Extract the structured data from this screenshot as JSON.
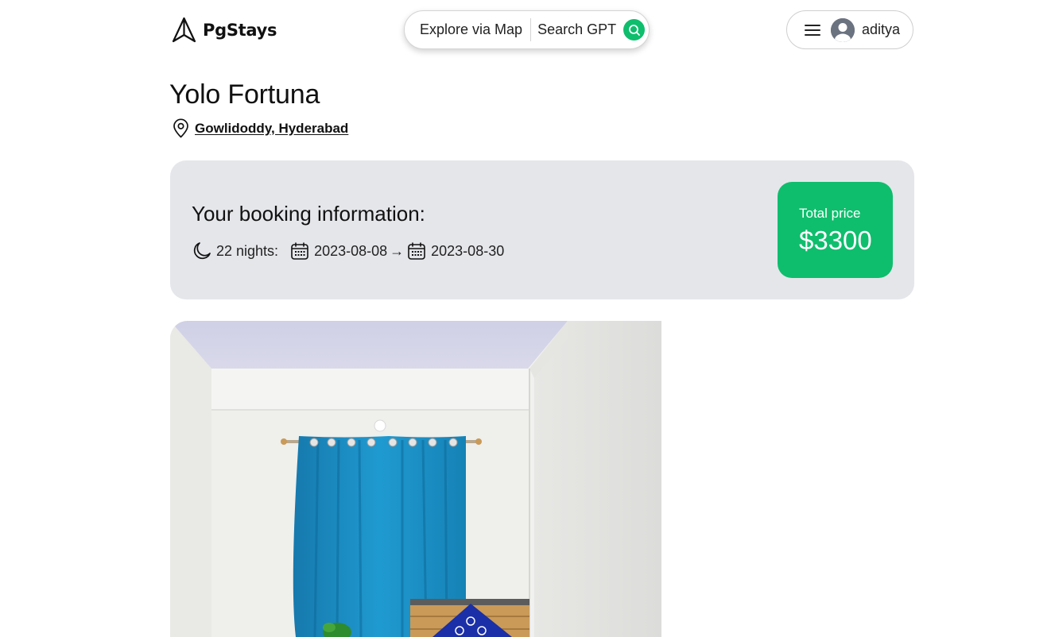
{
  "header": {
    "logo_text": "PgStays",
    "search": {
      "explore_label": "Explore via Map",
      "gpt_label": "Search GPT"
    },
    "user": {
      "name": "aditya"
    }
  },
  "listing": {
    "title": "Yolo Fortuna",
    "address": "Gowlidoddy, Hyderabad"
  },
  "booking": {
    "heading": "Your booking information:",
    "nights_text": "22 nights:",
    "check_in": "2023-08-08",
    "arrow": "→",
    "check_out": "2023-08-30",
    "price_label": "Total price",
    "price_value": "$3300"
  },
  "colors": {
    "accent": "#0ebe6d",
    "panel_bg": "#e5e6ea",
    "curtain": "#1a8fc4",
    "pillow": "#1a2fa8"
  },
  "icons": {
    "logo": "paper-plane-icon",
    "search": "search-icon",
    "menu": "hamburger-icon",
    "avatar": "user-avatar-icon",
    "location": "map-pin-icon",
    "nights": "moon-icon",
    "calendar": "calendar-icon"
  }
}
